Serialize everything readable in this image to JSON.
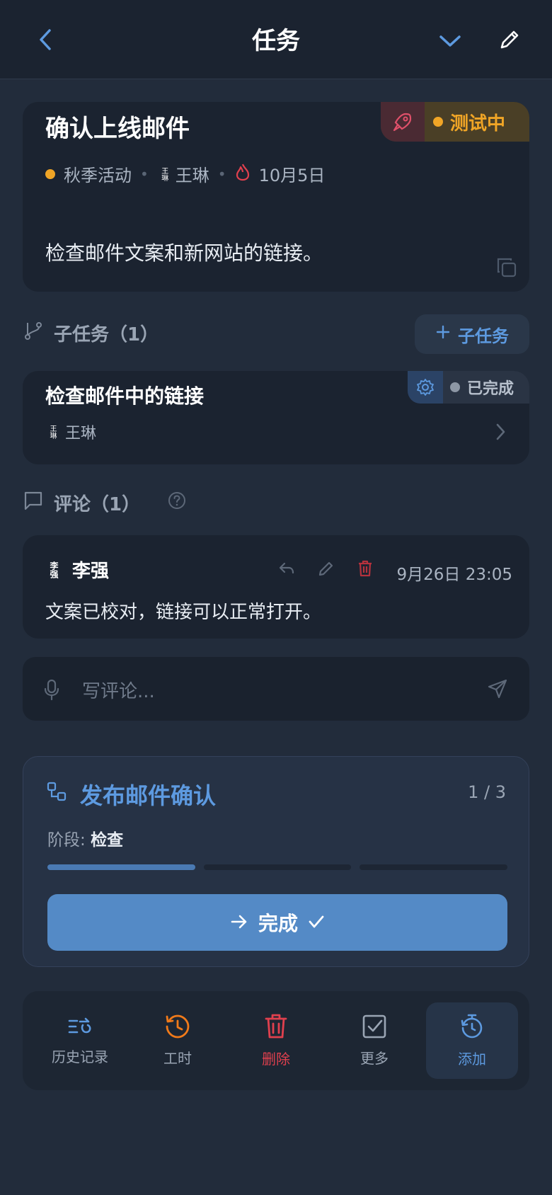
{
  "header": {
    "title": "任务"
  },
  "task": {
    "title": "确认上线邮件",
    "status": "测试中",
    "project": "秋季活动",
    "assignee_avatar": "王琳",
    "assignee": "王琳",
    "due_date": "10月5日",
    "description": "检查邮件文案和新网站的链接。"
  },
  "subtasks": {
    "heading": "子任务（1）",
    "add_label": "子任务",
    "items": [
      {
        "title": "检查邮件中的链接",
        "status": "已完成",
        "assignee_avatar": "王琳",
        "assignee": "王琳"
      }
    ]
  },
  "comments": {
    "heading": "评论（1）",
    "items": [
      {
        "avatar": "李强",
        "author": "李强",
        "time": "9月26日 23:05",
        "text": "文案已校对，链接可以正常打开。"
      }
    ],
    "input_placeholder": "写评论..."
  },
  "workflow": {
    "title": "发布邮件确认",
    "step": "1 / 3",
    "stage_label": "阶段:",
    "stage_value": "检查",
    "progress_steps_done": 1,
    "progress_steps_total": 3,
    "complete_label": "完成"
  },
  "bottom_bar": {
    "items": [
      {
        "label": "历史记录",
        "icon": "history-list-icon"
      },
      {
        "label": "工时",
        "icon": "time-history-icon"
      },
      {
        "label": "删除",
        "icon": "trash-icon"
      },
      {
        "label": "更多",
        "icon": "checkbox-icon"
      },
      {
        "label": "添加",
        "icon": "timer-icon"
      }
    ]
  },
  "colors": {
    "accent": "#5d9ae0",
    "testing": "#f0a526",
    "danger": "#e0404e",
    "timer_orange": "#f07a1a"
  }
}
